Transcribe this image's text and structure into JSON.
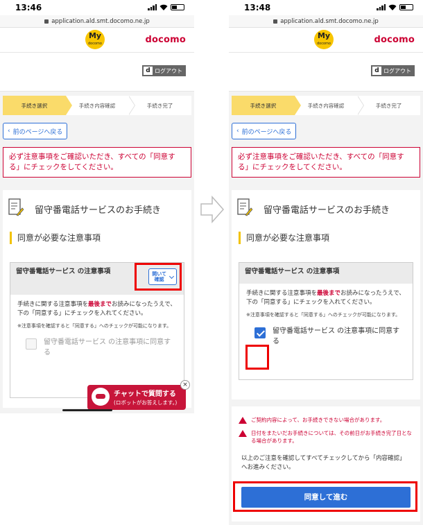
{
  "left": {
    "time": "13:46",
    "url": "application.ald.smt.docomo.ne.jp",
    "brand": {
      "my_top": "My",
      "my_bottom": "docomo",
      "docomo": "docomo"
    },
    "logout": {
      "d": "d",
      "label": "ログアウト"
    },
    "steps": [
      "手続き選択",
      "手続き内容確認",
      "手続き完了"
    ],
    "back_label": "前のページへ戻る",
    "alert": "必ず注意事項をご確認いただき、すべての「同意する」にチェックをしてください。",
    "card_title": "留守番電話サービスのお手続き",
    "subhead": "同意が必要な注意事項",
    "terms_title": "留守番電話サービス の注意事項",
    "toggle_label_1": "開いて",
    "toggle_label_2": "確認",
    "terms_text_1": "手続きに関する注意事項を",
    "terms_text_red": "最後まで",
    "terms_text_2": "お読みになったうえで、下の「同意する」にチェックを入れてください。",
    "terms_note": "※注意事項を確認すると「同意する」へのチェックが可能になります。",
    "checkbox_label": "留守番電話サービス の注意事項に同意する",
    "checked": false,
    "chat": {
      "title": "チャットで質問する",
      "sub": "(ロボットがお答えします。)",
      "close": "×"
    }
  },
  "right": {
    "time": "13:48",
    "url": "application.ald.smt.docomo.ne.jp",
    "brand": {
      "my_top": "My",
      "my_bottom": "docomo",
      "docomo": "docomo"
    },
    "logout": {
      "d": "d",
      "label": "ログアウト"
    },
    "steps": [
      "手続き選択",
      "手続き内容確認",
      "手続き完了"
    ],
    "back_label": "前のページへ戻る",
    "alert": "必ず注意事項をご確認いただき、すべての「同意する」にチェックをしてください。",
    "card_title": "留守番電話サービスのお手続き",
    "subhead": "同意が必要な注意事項",
    "terms_title": "留守番電話サービス の注意事項",
    "terms_text_1": "手続きに関する注意事項を",
    "terms_text_red": "最後まで",
    "terms_text_2": "お読みになったうえで、下の「同意する」にチェックを入れてください。",
    "terms_note": "※注意事項を確認すると「同意する」へのチェックが可能になります。",
    "checkbox_label": "留守番電話サービス の注意事項に同意する",
    "checked": true,
    "warnings": [
      "ご契約内容によって、お手続きできない場合があります。",
      "日付をまたいだお手続きについては、その前日がお手続き完了日となる場合があります。"
    ],
    "confirm_text": "以上のご注意を確認してすべてチェックしてから「内容確認」へお進みください。",
    "agree_button": "同意して進む"
  },
  "colors": {
    "accent": "#2d6fd6",
    "alert": "#cc0033",
    "step_active": "#fadb6a",
    "highlight": "#ee0000"
  }
}
